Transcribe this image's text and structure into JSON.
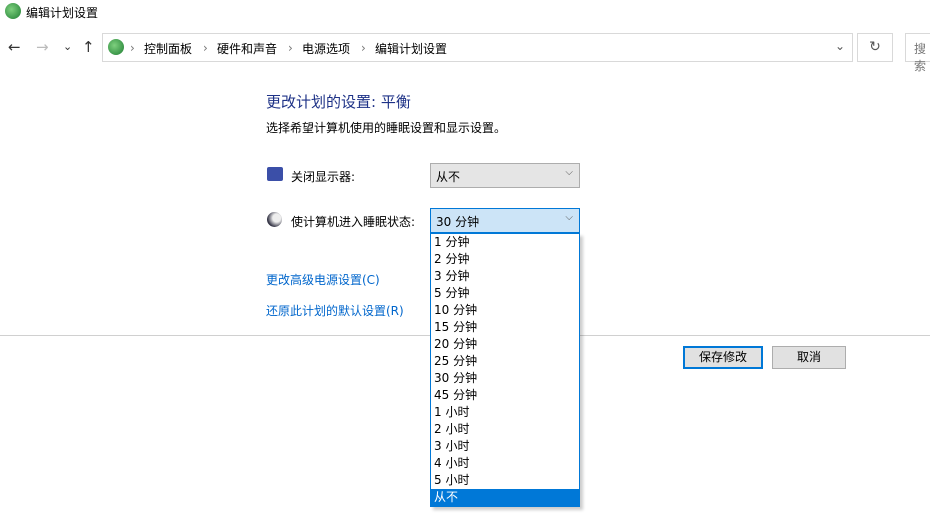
{
  "window": {
    "title": "编辑计划设置"
  },
  "nav": {
    "back": "←",
    "forward": "→",
    "recent": "⌄",
    "up": "↑",
    "refresh": "↻",
    "search_placeholder": "搜索",
    "dropdown": "⌄"
  },
  "breadcrumb": [
    "控制面板",
    "硬件和声音",
    "电源选项",
    "编辑计划设置"
  ],
  "main": {
    "heading": "更改计划的设置: 平衡",
    "subtitle": "选择希望计算机使用的睡眠设置和显示设置。",
    "display_label": "关闭显示器:",
    "display_value": "从不",
    "sleep_label": "使计算机进入睡眠状态:",
    "sleep_value": "30 分钟",
    "sleep_options": [
      "1 分钟",
      "2 分钟",
      "3 分钟",
      "5 分钟",
      "10 分钟",
      "15 分钟",
      "20 分钟",
      "25 分钟",
      "30 分钟",
      "45 分钟",
      "1 小时",
      "2 小时",
      "3 小时",
      "4 小时",
      "5 小时",
      "从不"
    ],
    "highlighted_option": "从不",
    "advanced_link": "更改高级电源设置(C)",
    "restore_link": "还原此计划的默认设置(R)",
    "save": "保存修改",
    "cancel": "取消"
  },
  "colors": {
    "accent": "#0078d7",
    "heading": "#1e3287",
    "link": "#0066cc"
  }
}
